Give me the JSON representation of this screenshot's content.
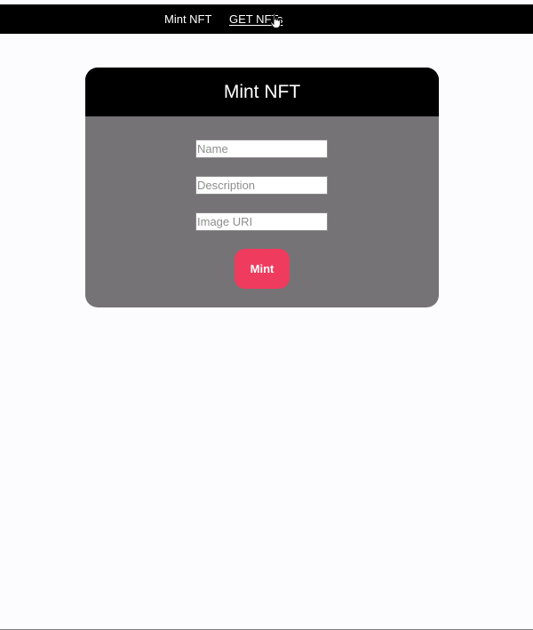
{
  "nav": {
    "mint_label": "Mint NFT",
    "get_label": "GET NFTs"
  },
  "card": {
    "title": "Mint NFT",
    "fields": {
      "name_placeholder": "Name",
      "description_placeholder": "Description",
      "image_uri_placeholder": "Image URI"
    },
    "button_label": "Mint"
  },
  "colors": {
    "topbar": "#000000",
    "card_body": "#757376",
    "button": "#ef3b5d",
    "page_background": "#fcfbfd"
  },
  "icons": {
    "cursor": "hand-pointer-icon"
  }
}
